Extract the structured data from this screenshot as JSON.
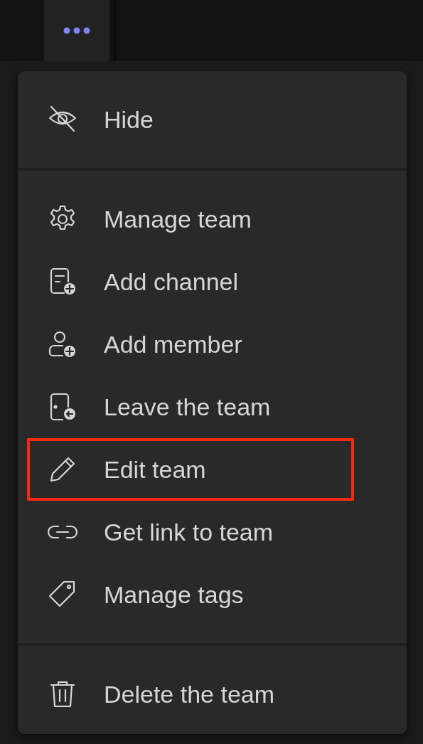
{
  "sections": [
    {
      "items": [
        {
          "kind": "hide",
          "label": "Hide",
          "highlighted": false
        }
      ]
    },
    {
      "items": [
        {
          "kind": "settings",
          "label": "Manage team",
          "highlighted": false
        },
        {
          "kind": "add-channel",
          "label": "Add channel",
          "highlighted": false
        },
        {
          "kind": "add-member",
          "label": "Add member",
          "highlighted": false
        },
        {
          "kind": "leave",
          "label": "Leave the team",
          "highlighted": false
        },
        {
          "kind": "edit",
          "label": "Edit team",
          "highlighted": true
        },
        {
          "kind": "link",
          "label": "Get link to team",
          "highlighted": false
        },
        {
          "kind": "tag",
          "label": "Manage tags",
          "highlighted": false
        }
      ]
    },
    {
      "items": [
        {
          "kind": "delete",
          "label": "Delete the team",
          "highlighted": false
        }
      ]
    }
  ]
}
